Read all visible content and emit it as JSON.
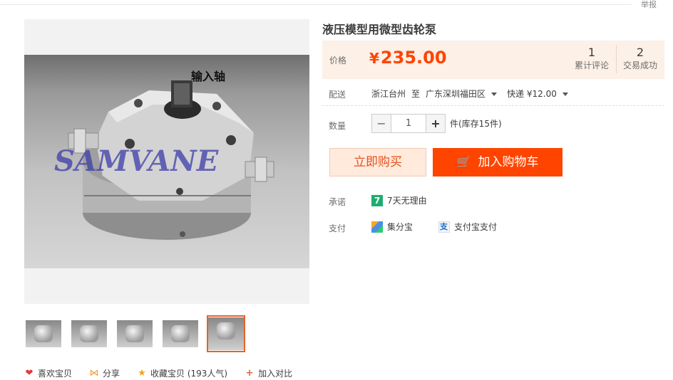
{
  "header": {
    "report_label": "举报"
  },
  "gallery": {
    "caption": "输入轴",
    "watermark": "SAMVANE",
    "thumbnails": [
      "thumb-1",
      "thumb-2",
      "thumb-3",
      "thumb-4",
      "thumb-5"
    ],
    "active_index": 4
  },
  "actions": {
    "like": "喜欢宝贝",
    "share": "分享",
    "collect": "收藏宝贝 (193人气)",
    "compare": "加入对比"
  },
  "product": {
    "title": "液压模型用微型齿轮泵",
    "price_label": "价格",
    "currency": "¥",
    "price": "235.00",
    "reviews_count": "1",
    "reviews_label": "累计评论",
    "deals_count": "2",
    "deals_label": "交易成功"
  },
  "shipping": {
    "label": "配送",
    "from": "浙江台州",
    "to_word": "至",
    "to": "广东深圳福田区",
    "method": "快递 ¥12.00"
  },
  "quantity": {
    "label": "数量",
    "value": "1",
    "minus": "−",
    "plus": "+",
    "stock": "件(库存15件)"
  },
  "buttons": {
    "buy_now": "立即购买",
    "add_cart": "加入购物车"
  },
  "promise": {
    "label": "承诺",
    "badge": "7",
    "text": "7天无理由"
  },
  "payment": {
    "label": "支付",
    "method1": "集分宝",
    "method2": "支付宝支付"
  },
  "colors": {
    "accent": "#ff4400",
    "price_bg": "#fdf0e6",
    "thumb_active": "#e4632a"
  },
  "icons": [
    "heart-icon",
    "share-icon",
    "star-icon",
    "plus-icon",
    "cart-icon",
    "jifenbao-icon",
    "alipay-icon"
  ]
}
